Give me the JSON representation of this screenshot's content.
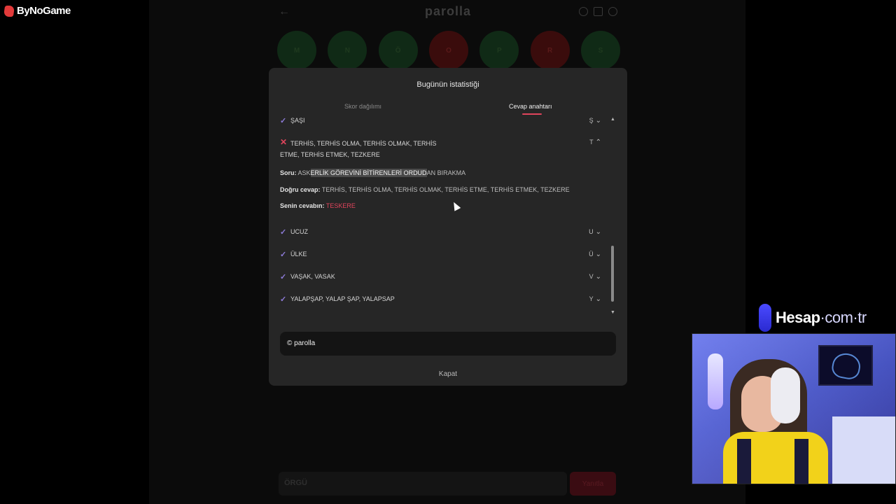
{
  "overlay": {
    "brand": "ByNoGame",
    "sponsor_main": "Hesap",
    "sponsor_domain": "·com·tr"
  },
  "game": {
    "title": "parolla",
    "circles": [
      {
        "letter": "M",
        "state": "correct"
      },
      {
        "letter": "N",
        "state": "correct"
      },
      {
        "letter": "Ö",
        "state": "correct"
      },
      {
        "letter": "O",
        "state": "wrong"
      },
      {
        "letter": "P",
        "state": "correct"
      },
      {
        "letter": "R",
        "state": "wrong"
      },
      {
        "letter": "S",
        "state": "correct"
      }
    ],
    "input_placeholder": "ÖRGÜ",
    "submit_label": "Yanıtla"
  },
  "modal": {
    "title": "Bugünün istatistiği",
    "tab_score": "Skor dağılımı",
    "tab_key": "Cevap anahtarı",
    "rows": [
      {
        "answer": "ŞAŞI",
        "letter": "Ş",
        "status": "correct"
      },
      {
        "answer_line1": "TERHİS, TERHİS OLMA, TERHİS OLMAK, TERHİS",
        "answer_line2": "ETME, TERHİS ETMEK, TEZKERE",
        "letter": "T",
        "status": "wrong",
        "expanded": true
      },
      {
        "answer": "UCUZ",
        "letter": "U",
        "status": "correct"
      },
      {
        "answer": "ÜLKE",
        "letter": "Ü",
        "status": "correct"
      },
      {
        "answer": "VAŞAK, VASAK",
        "letter": "V",
        "status": "correct"
      },
      {
        "answer": "YALAPŞAP, YALAP ŞAP, YALAPSAP",
        "letter": "Y",
        "status": "correct"
      }
    ],
    "detail": {
      "question_label": "Soru:",
      "question_pre": "ASK",
      "question_highlight": "ERLİK GÖREVİNİ BİTİRENLERİ ORDUD",
      "question_post": "AN BIRAKMA",
      "correct_label": "Doğru cevap:",
      "correct_value": "TERHİS, TERHİS OLMA, TERHİS OLMAK, TERHİS ETME, TERHİS ETMEK, TEZKERE",
      "yours_label": "Senin cevabın:",
      "yours_value": "TESKERE"
    },
    "share": "© parolla",
    "close": "Kapat"
  }
}
